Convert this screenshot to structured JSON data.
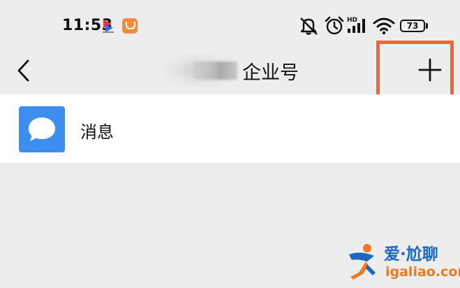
{
  "status_bar": {
    "time": "11:53",
    "battery": "73",
    "network_label": "HD",
    "icons": [
      "app-icon",
      "app-icon",
      "mute-icon",
      "alarm-icon",
      "signal-icon",
      "wifi-icon",
      "battery-icon"
    ]
  },
  "header": {
    "title": "企业号",
    "back_icon": "chevron-left-icon",
    "add_icon": "plus-icon",
    "highlight_color": "#f0633b"
  },
  "list": {
    "items": [
      {
        "label": "消息",
        "icon": "message-icon",
        "icon_color": "#3e8ef0"
      }
    ]
  },
  "watermark": {
    "name": "爱·尬聊",
    "site": "igaliao.com"
  }
}
